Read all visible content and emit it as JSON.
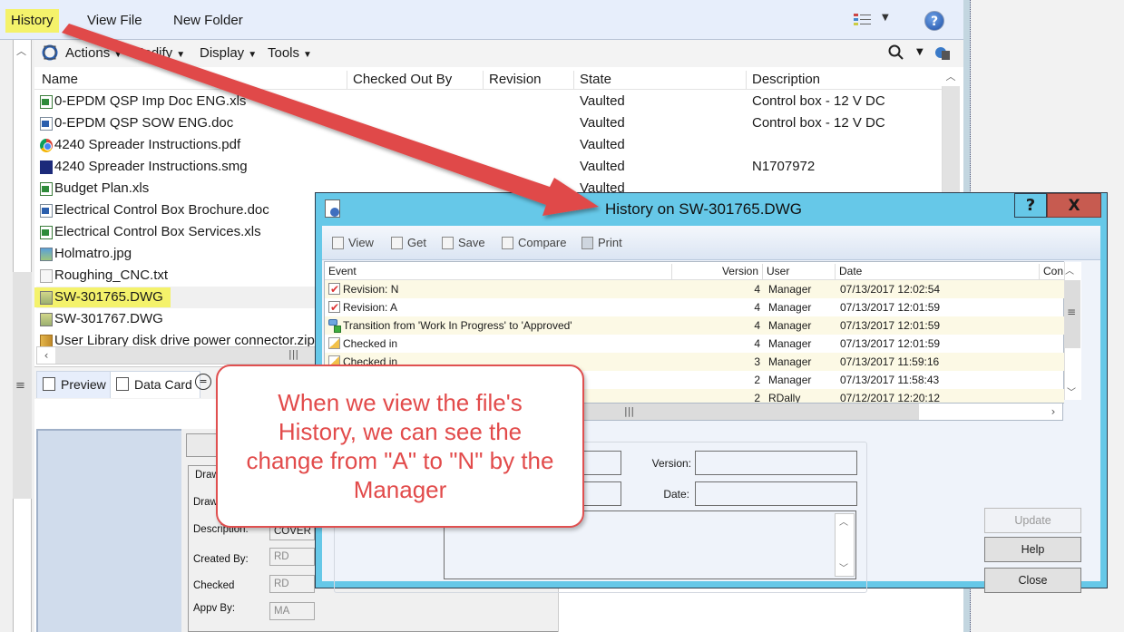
{
  "ribbon": {
    "history_label": "History",
    "view_file_label": "View File",
    "new_folder_label": "New Folder"
  },
  "toolbar": {
    "actions_label": "Actions",
    "modify_label": "Modify",
    "display_label": "Display",
    "tools_label": "Tools"
  },
  "file_list": {
    "columns": [
      "Name",
      "Checked Out By",
      "Revision",
      "State",
      "Description"
    ],
    "rows": [
      {
        "name": "0-EPDM QSP Imp Doc ENG.xls",
        "icon": "excel-file-icon",
        "state": "Vaulted",
        "description": "Control box - 12 V DC"
      },
      {
        "name": "0-EPDM QSP SOW ENG.doc",
        "icon": "word-file-icon",
        "state": "Vaulted",
        "description": "Control box - 12 V DC"
      },
      {
        "name": "4240 Spreader Instructions.pdf",
        "icon": "pdf-file-icon",
        "state": "Vaulted",
        "description": ""
      },
      {
        "name": "4240 Spreader Instructions.smg",
        "icon": "smg-file-icon",
        "state": "Vaulted",
        "description": "N1707972"
      },
      {
        "name": "Budget Plan.xls",
        "icon": "excel-file-icon",
        "state": "Vaulted",
        "description": ""
      },
      {
        "name": "Electrical Control Box Brochure.doc",
        "icon": "word-file-icon",
        "state": "",
        "description": ""
      },
      {
        "name": "Electrical Control Box Services.xls",
        "icon": "excel-file-icon",
        "state": "",
        "description": ""
      },
      {
        "name": "Holmatro.jpg",
        "icon": "image-file-icon",
        "state": "",
        "description": ""
      },
      {
        "name": "Roughing_CNC.txt",
        "icon": "text-file-icon",
        "state": "",
        "description": ""
      },
      {
        "name": "SW-301765.DWG",
        "icon": "dwg-file-icon",
        "state": "",
        "description": ""
      },
      {
        "name": "SW-301767.DWG",
        "icon": "dwg-file-icon",
        "state": "",
        "description": ""
      },
      {
        "name": "User Library disk drive power connector.zip",
        "icon": "zip-file-icon",
        "state": "",
        "description": ""
      }
    ],
    "selected": "SW-301765.DWG"
  },
  "tabs": {
    "preview_label": "Preview",
    "datacard_label": "Data Card"
  },
  "data_card": {
    "fields": [
      {
        "label": "Draw",
        "value": ""
      },
      {
        "label": "Draw",
        "value": ""
      },
      {
        "label": "Description:",
        "value": "COVER"
      },
      {
        "label": "Created By:",
        "value": "RD"
      },
      {
        "label": "Checked",
        "value": "RD"
      },
      {
        "label": "Appv By:",
        "value": "MA"
      }
    ]
  },
  "dialog": {
    "title": "History on SW-301765.DWG",
    "help_button": "?",
    "close_button": "X",
    "toolbar": {
      "view": "View",
      "get": "Get",
      "save": "Save",
      "compare": "Compare",
      "print": "Print"
    },
    "columns": [
      "Event",
      "Version",
      "User",
      "Date",
      "Con"
    ],
    "rows": [
      {
        "event": "Revision: N",
        "icon": "revision-icon",
        "version": "4",
        "user": "Manager",
        "date": "07/13/2017 12:02:54"
      },
      {
        "event": "Revision: A",
        "icon": "revision-icon",
        "version": "4",
        "user": "Manager",
        "date": "07/13/2017 12:01:59"
      },
      {
        "event": "Transition from 'Work In Progress' to 'Approved'",
        "icon": "transition-icon",
        "version": "4",
        "user": "Manager",
        "date": "07/13/2017 12:01:59"
      },
      {
        "event": "Checked in",
        "icon": "checked-in-icon",
        "version": "4",
        "user": "Manager",
        "date": "07/13/2017 12:01:59"
      },
      {
        "event": "Checked in",
        "icon": "checked-in-icon",
        "version": "3",
        "user": "Manager",
        "date": "07/13/2017 11:59:16"
      },
      {
        "event": "",
        "icon": "",
        "version": "2",
        "user": "Manager",
        "date": "07/13/2017 11:58:43"
      },
      {
        "event": "",
        "icon": "",
        "version": "2",
        "user": "RDally",
        "date": "07/12/2017 12:20:12"
      }
    ],
    "detail": {
      "version_label": "Version:",
      "date_label": "Date:",
      "version_value": "",
      "date_value": ""
    },
    "buttons": {
      "update": "Update",
      "help": "Help",
      "close": "Close"
    }
  },
  "callout": {
    "text": "When we view the file's History, we can see the change from \"A\" to \"N\" by the Manager"
  },
  "colors": {
    "highlight": "#f4f26b",
    "dialog_frame": "#66c8e8",
    "close_button": "#c75b50",
    "callout_text": "#e24b4b",
    "arrow": "#e04848",
    "alt_row": "#fcf9e5"
  }
}
